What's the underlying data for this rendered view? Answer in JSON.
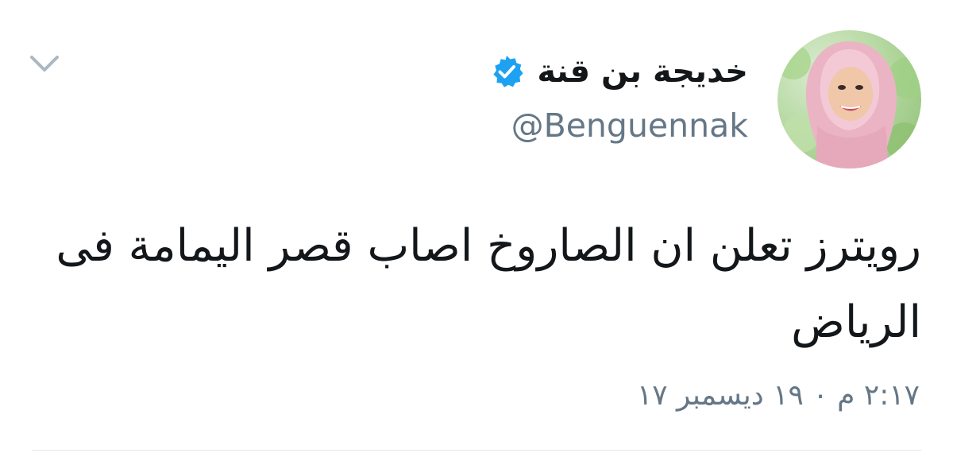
{
  "tweet": {
    "author": {
      "display_name": "خديجة بن قنة",
      "handle": "@Benguennak",
      "verified": true
    },
    "text": "رويترز تعلن ان الصاروخ اصاب قصر اليمامة فى الرياض",
    "timestamp": "٢:١٧ م ٠ ١٩ ديسمبر ١٧"
  },
  "icons": {
    "verified": "verified-badge-icon",
    "caret": "chevron-down-icon"
  },
  "colors": {
    "verified_blue": "#1da1f2",
    "text": "#14171a",
    "secondary": "#657786",
    "divider": "#e1e8ed"
  }
}
